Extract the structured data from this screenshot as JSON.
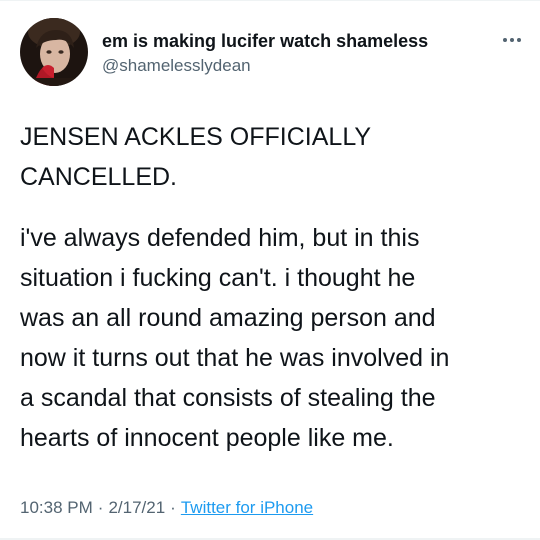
{
  "tweet": {
    "author": {
      "display_name": "em is making lucifer watch shameless",
      "handle": "@shamelesslydean"
    },
    "headline_line1": "JENSEN ACKLES OFFICIALLY",
    "headline_line2": "CANCELLED.",
    "body_lines": [
      "i've always defended him, but in this",
      "situation i fucking can't. i thought he",
      "was an all round amazing person and",
      "now it turns out that he was involved in",
      "a scandal that consists of stealing the",
      "hearts of innocent people like me."
    ],
    "time": "10:38 PM",
    "separator": "·",
    "date": "2/17/21",
    "source": "Twitter for iPhone"
  },
  "colors": {
    "text": "#0f1419",
    "secondary": "#536471",
    "link": "#1d9bf0"
  },
  "icons": {
    "more": "more-horizontal-icon"
  }
}
